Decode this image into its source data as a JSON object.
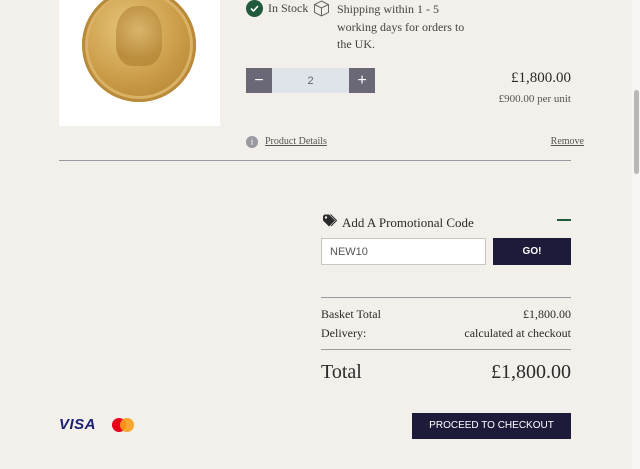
{
  "product": {
    "image_alt": "gold sovereign coin",
    "stock_status": "In Stock",
    "shipping": "Shipping within 1 - 5 working days for orders to the UK.",
    "quantity": "2",
    "line_price": "£1,800.00",
    "unit_price": "£900.00 per unit",
    "details_link": "Product Details",
    "remove_link": "Remove",
    "qty_minus": "−",
    "qty_plus": "+"
  },
  "promo": {
    "title": "Add A Promotional Code",
    "code_value": "NEW10",
    "go_label": "GO!"
  },
  "summary": {
    "basket_total_label": "Basket Total",
    "basket_total_value": "£1,800.00",
    "delivery_label": "Delivery:",
    "delivery_value": "calculated at checkout",
    "total_label": "Total",
    "total_value": "£1,800.00"
  },
  "payment": {
    "visa_label": "VISA"
  },
  "checkout": {
    "label": "PROCEED TO CHECKOUT"
  },
  "icons": {
    "stock": "check-circle-icon",
    "shipping": "box-icon",
    "info": "info-icon",
    "tag": "tag-icon",
    "collapse": "minus-icon",
    "mastercard": "mastercard-icon"
  },
  "colors": {
    "background": "#f3efea",
    "brand_navy": "#1d1b3a",
    "stock_green": "#1f5a3c",
    "qty_button": "#6a6877"
  }
}
